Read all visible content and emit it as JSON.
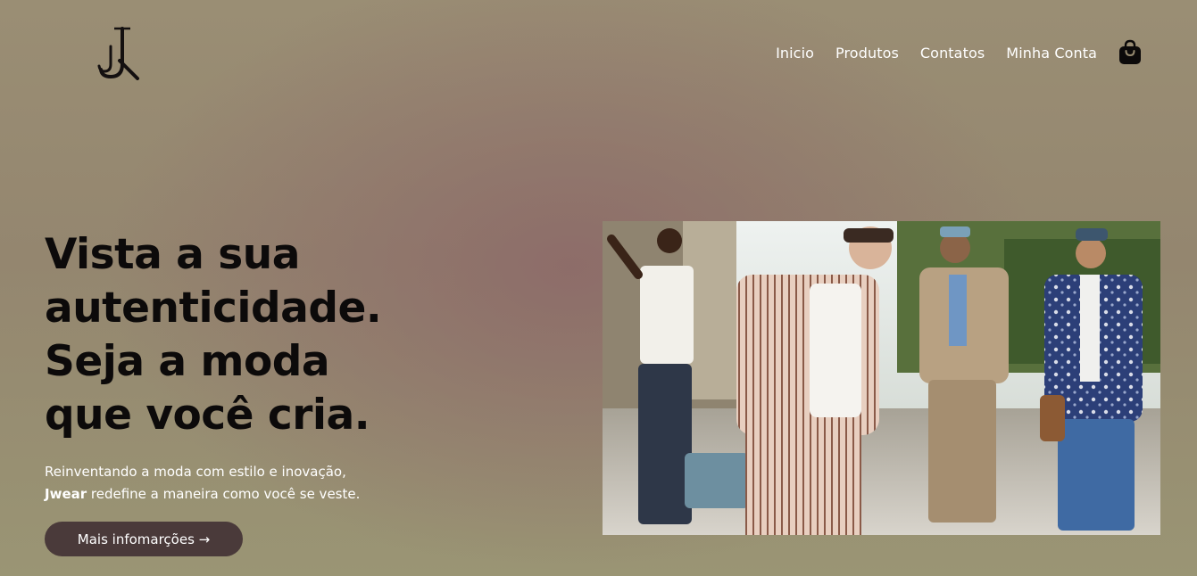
{
  "header": {
    "logo_text": "JJ",
    "nav": [
      "Inicio",
      "Produtos",
      "Contatos",
      "Minha Conta"
    ],
    "cart_icon": "shopping-bag-icon"
  },
  "hero": {
    "title_lines": [
      "Vista a sua",
      "autenticidade.",
      "Seja a moda",
      "que você cria."
    ],
    "subtitle_line1": "Reinventando a moda com estilo e inovação,",
    "brand": "Jwear",
    "subtitle_line2_rest": " redefine a maneira como você se veste.",
    "cta_label": "Mais infomarções →",
    "image_alt": "Quatro homens caminhando na rua com roupas de moda"
  },
  "colors": {
    "background": "#968a70",
    "button": "#4a3a3a",
    "title": "#0c0a0a",
    "nav_text": "#ffffff"
  }
}
